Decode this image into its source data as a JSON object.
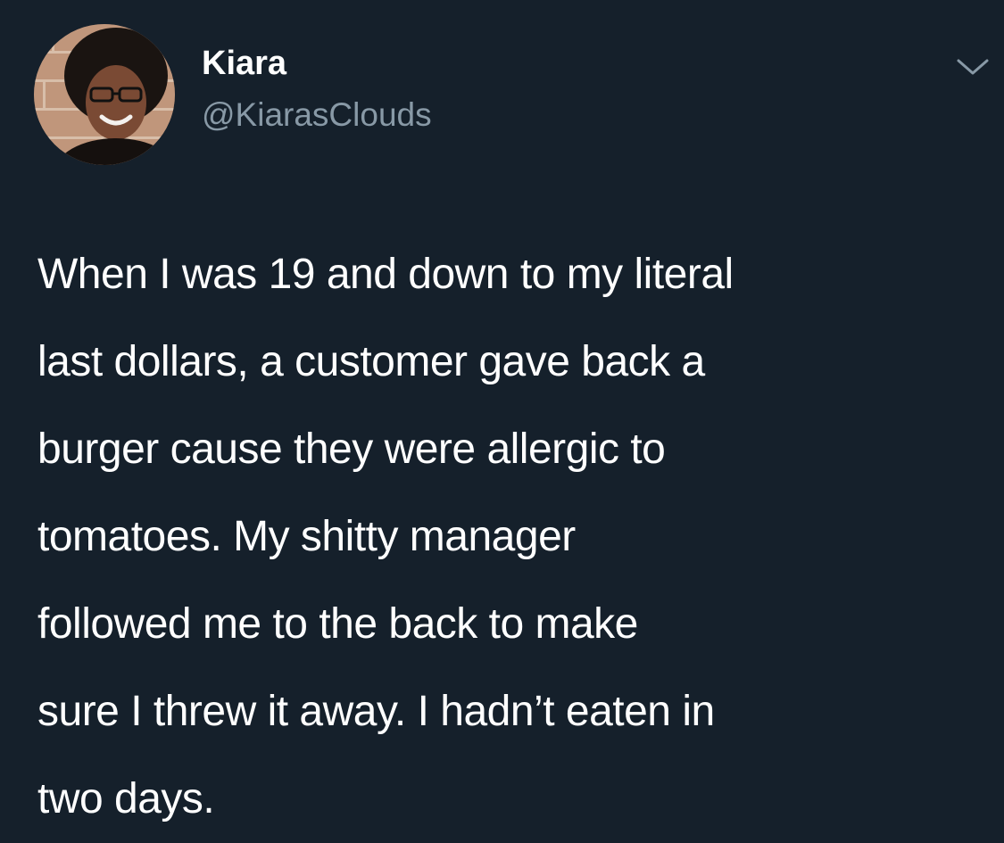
{
  "user": {
    "name": "Kiara",
    "handle": "@KiarasClouds",
    "avatar_icon": "profile-photo"
  },
  "menu": {
    "icon": "chevron-down-icon"
  },
  "tweet": {
    "text": "When I was 19 and down to my literal\nlast dollars, a customer gave back a\nburger cause they were allergic to\ntomatoes. My shitty manager\nfollowed me to the back to make\nsure I threw it away. I hadn’t eaten in\ntwo days."
  },
  "colors": {
    "background": "#15202b",
    "primary_text": "#ffffff",
    "secondary_text": "#8899a6"
  }
}
